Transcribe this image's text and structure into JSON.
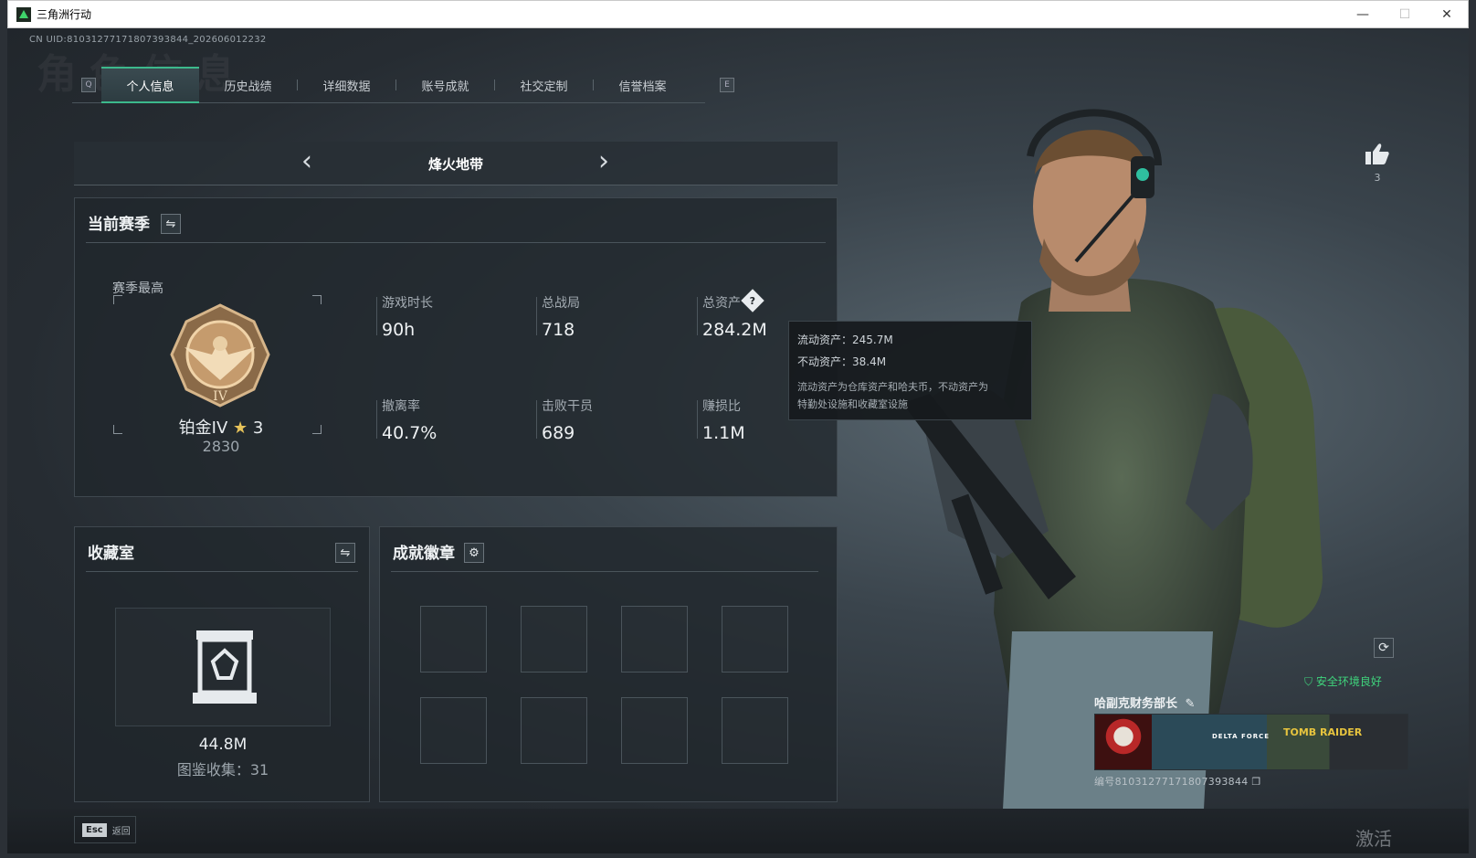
{
  "window": {
    "title": "三角洲行动",
    "controls": {
      "minimize": "—",
      "maximize": "☐",
      "close": "✕"
    }
  },
  "uid_text": "CN UID:81031277171807393844_202606012232",
  "background_title": "角色信息",
  "tabs": {
    "q_key": "Q",
    "e_key": "E",
    "items": [
      {
        "label": "个人信息",
        "active": true
      },
      {
        "label": "历史战绩",
        "active": false
      },
      {
        "label": "详细数据",
        "active": false
      },
      {
        "label": "账号成就",
        "active": false
      },
      {
        "label": "社交定制",
        "active": false
      },
      {
        "label": "信誉档案",
        "active": false
      }
    ]
  },
  "mode": {
    "title": "烽火地带",
    "prev": "‹",
    "next": "›"
  },
  "season": {
    "title": "当前赛季",
    "best_label": "赛季最高",
    "rank_name": "铂金IV",
    "rank_stars": "3",
    "rank_score": "2830",
    "stats": [
      {
        "label": "游戏时长",
        "value": "90h"
      },
      {
        "label": "总战局",
        "value": "718"
      },
      {
        "label": "总资产",
        "value": "284.2M"
      },
      {
        "label": "撤离率",
        "value": "40.7%"
      },
      {
        "label": "击败干员",
        "value": "689"
      },
      {
        "label": "赚损比",
        "value": "1.1M"
      }
    ]
  },
  "tooltip": {
    "liquid": "流动资产：245.7M",
    "fixed": "不动资产：38.4M",
    "desc_line1": "流动资产为仓库资产和哈夫币，不动资产为",
    "desc_line2": "特勤处设施和收藏室设施"
  },
  "collection": {
    "title": "收藏室",
    "value": "44.8M",
    "count_text": "图鉴收集：31"
  },
  "badges": {
    "title": "成就徽章",
    "slot_count": 8
  },
  "esc": {
    "key": "Esc",
    "label": "返回"
  },
  "like": {
    "count": "3"
  },
  "safety": {
    "text": "安全环境良好",
    "color": "#3fd47c"
  },
  "card": {
    "title": "哈副克财务部长",
    "logo_text": "DELTA FORCE",
    "logo_text2": "TOMB RAIDER",
    "id_text": "编号81031277171807393844"
  },
  "watermark": "激活 Windows",
  "colors": {
    "accent": "#3cb98c",
    "safe": "#3fd47c"
  }
}
